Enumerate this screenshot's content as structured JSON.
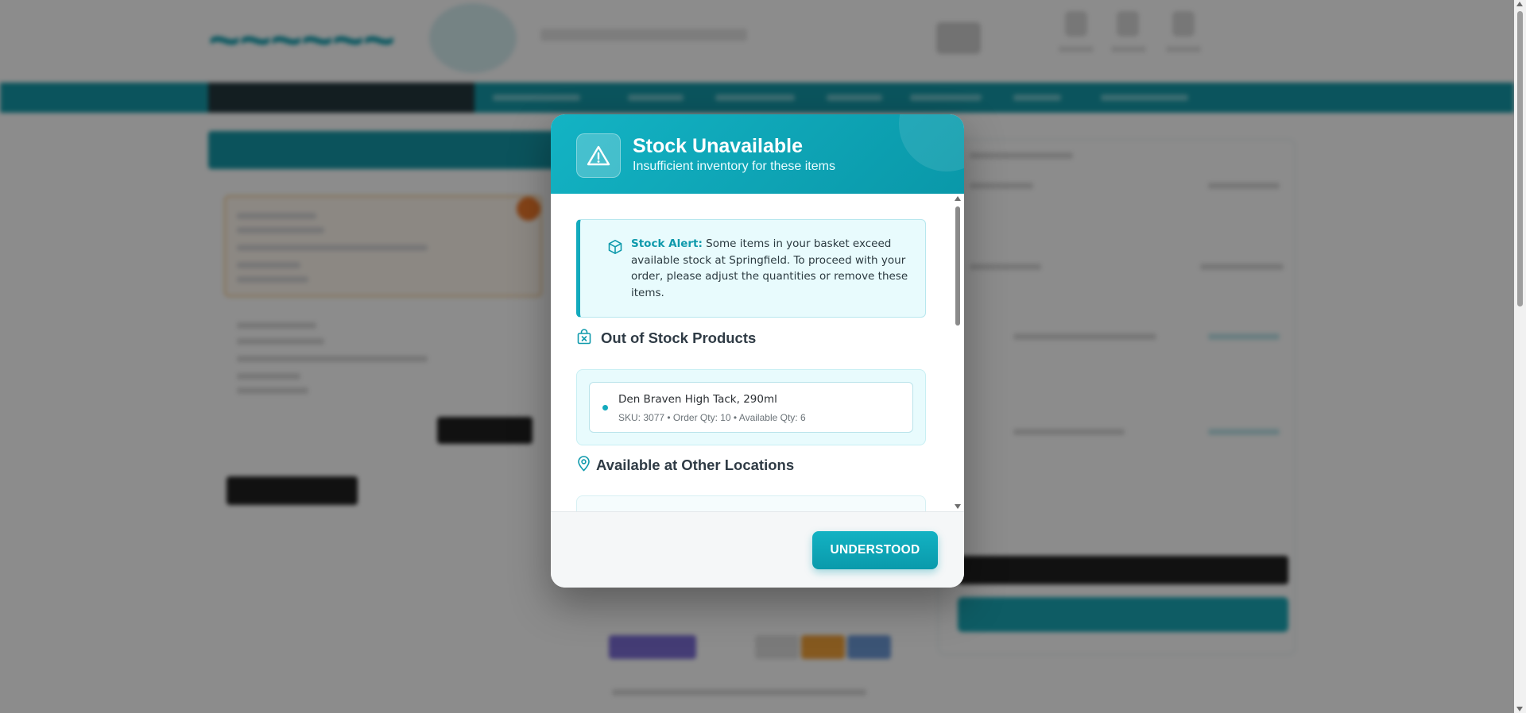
{
  "modal": {
    "title": "Stock Unavailable",
    "subtitle": "Insufficient inventory for these items",
    "alert": {
      "label": "Stock Alert:",
      "message": "Some items in your basket exceed available stock at Springfield. To proceed with your order, please adjust the quantities or remove these items."
    },
    "out_of_stock_heading": "Out of Stock Products",
    "out_of_stock_items": [
      {
        "name": "Den Braven High Tack, 290ml",
        "details": "SKU: 3077 • Order Qty: 10 • Available Qty: 6"
      }
    ],
    "other_locations_heading": "Available at Other Locations",
    "button_label": "UNDERSTOOD",
    "icons": {
      "header": "warning-triangle-icon",
      "alert": "package-icon",
      "out_of_stock": "box-x-icon",
      "locations": "map-pin-icon"
    }
  },
  "colors": {
    "accent": "#13aabd",
    "accent_dark": "#0a98a9",
    "alert_bg": "#e8fbfd",
    "overlay": "rgba(0,0,0,0.45)"
  }
}
